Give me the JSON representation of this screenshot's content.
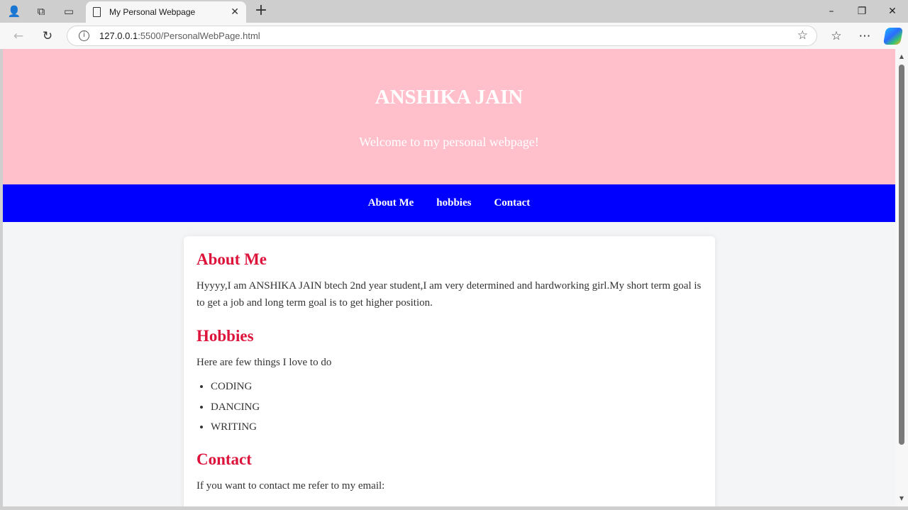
{
  "browser": {
    "tab_title": "My Personal Webpage",
    "url_host": "127.0.0.1",
    "url_path": ":5500/PersonalWebPage.html"
  },
  "page": {
    "header": {
      "title": "ANSHIKA JAIN",
      "subtitle": "Welcome to my personal webpage!"
    },
    "nav": [
      "About Me",
      "hobbies",
      "Contact"
    ],
    "about": {
      "heading": "About Me",
      "text": "Hyyyy,I am ANSHIKA JAIN btech 2nd year student,I am very determined and hardworking girl.My short term goal is to get a job and long term goal is to get higher position."
    },
    "hobbies": {
      "heading": "Hobbies",
      "intro": "Here are few things I love to do",
      "items": [
        "CODING",
        "DANCING",
        "WRITING"
      ]
    },
    "contact": {
      "heading": "Contact",
      "text": "If you want to contact me refer to my email:"
    }
  },
  "colors": {
    "header_bg": "#ffc0cb",
    "nav_bg": "#0000ff",
    "heading": "#dc143c"
  }
}
